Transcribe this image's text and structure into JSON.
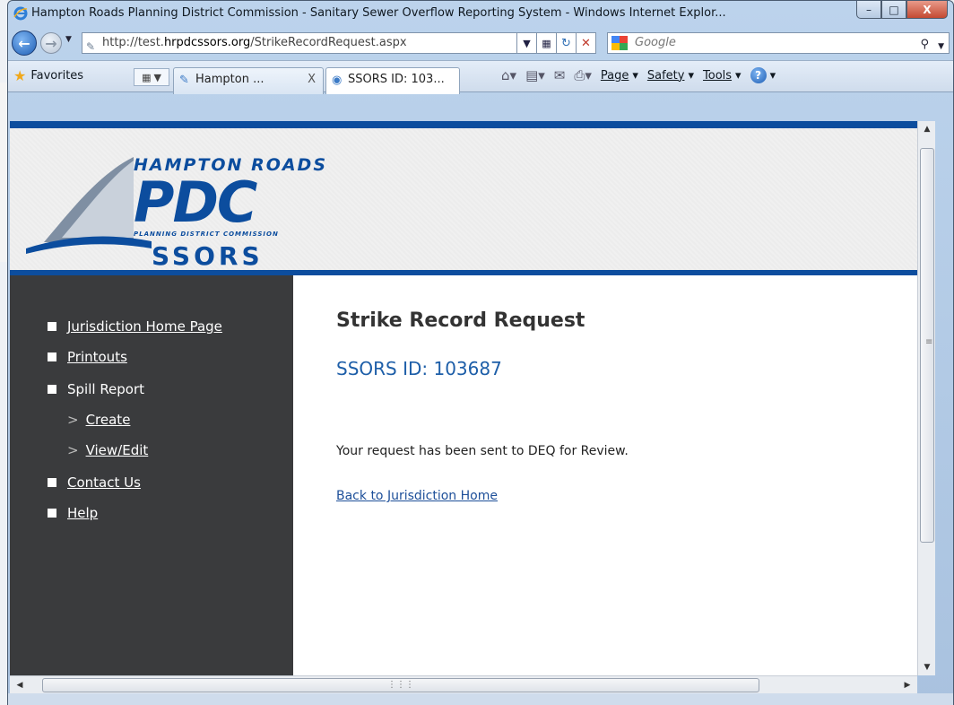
{
  "window": {
    "title": "Hampton Roads Planning District Commission - Sanitary Sewer Overflow Reporting System - Windows Internet Explor...",
    "min_label": "–",
    "max_label": "□",
    "close_label": "X"
  },
  "address": {
    "url_prefix": "http://test.",
    "url_domain": "hrpdcssors.org",
    "url_path": "/StrikeRecordRequest.aspx",
    "search_placeholder": "Google"
  },
  "favbar": {
    "favorites_label": "Favorites",
    "tabs": [
      {
        "label": "Hampton ...",
        "close": "X"
      },
      {
        "label": "SSORS ID: 103..."
      }
    ],
    "commands": {
      "page": "Page",
      "safety": "Safety",
      "tools": "Tools"
    }
  },
  "header": {
    "logo_line1": "HAMPTON ROADS",
    "logo_line2": "PDC",
    "logo_line3": "PLANNING DISTRICT COMMISSION",
    "logo_line4": "SSORS"
  },
  "sidebar": {
    "items": [
      {
        "label": "Jurisdiction Home Page"
      },
      {
        "label": "Printouts"
      },
      {
        "label": "Spill Report"
      },
      {
        "label": "Create"
      },
      {
        "label": "View/Edit"
      },
      {
        "label": "Contact Us"
      },
      {
        "label": "Help"
      }
    ]
  },
  "main": {
    "title": "Strike Record Request",
    "ssors_id": "SSORS ID: 103687",
    "message": "Your request has been sent to DEQ for Review.",
    "back_link": "Back to Jurisdiction Home"
  },
  "colors": {
    "brand_blue": "#0c4d9e",
    "sidebar": "#3a3b3d",
    "link_blue": "#1d4f99"
  }
}
